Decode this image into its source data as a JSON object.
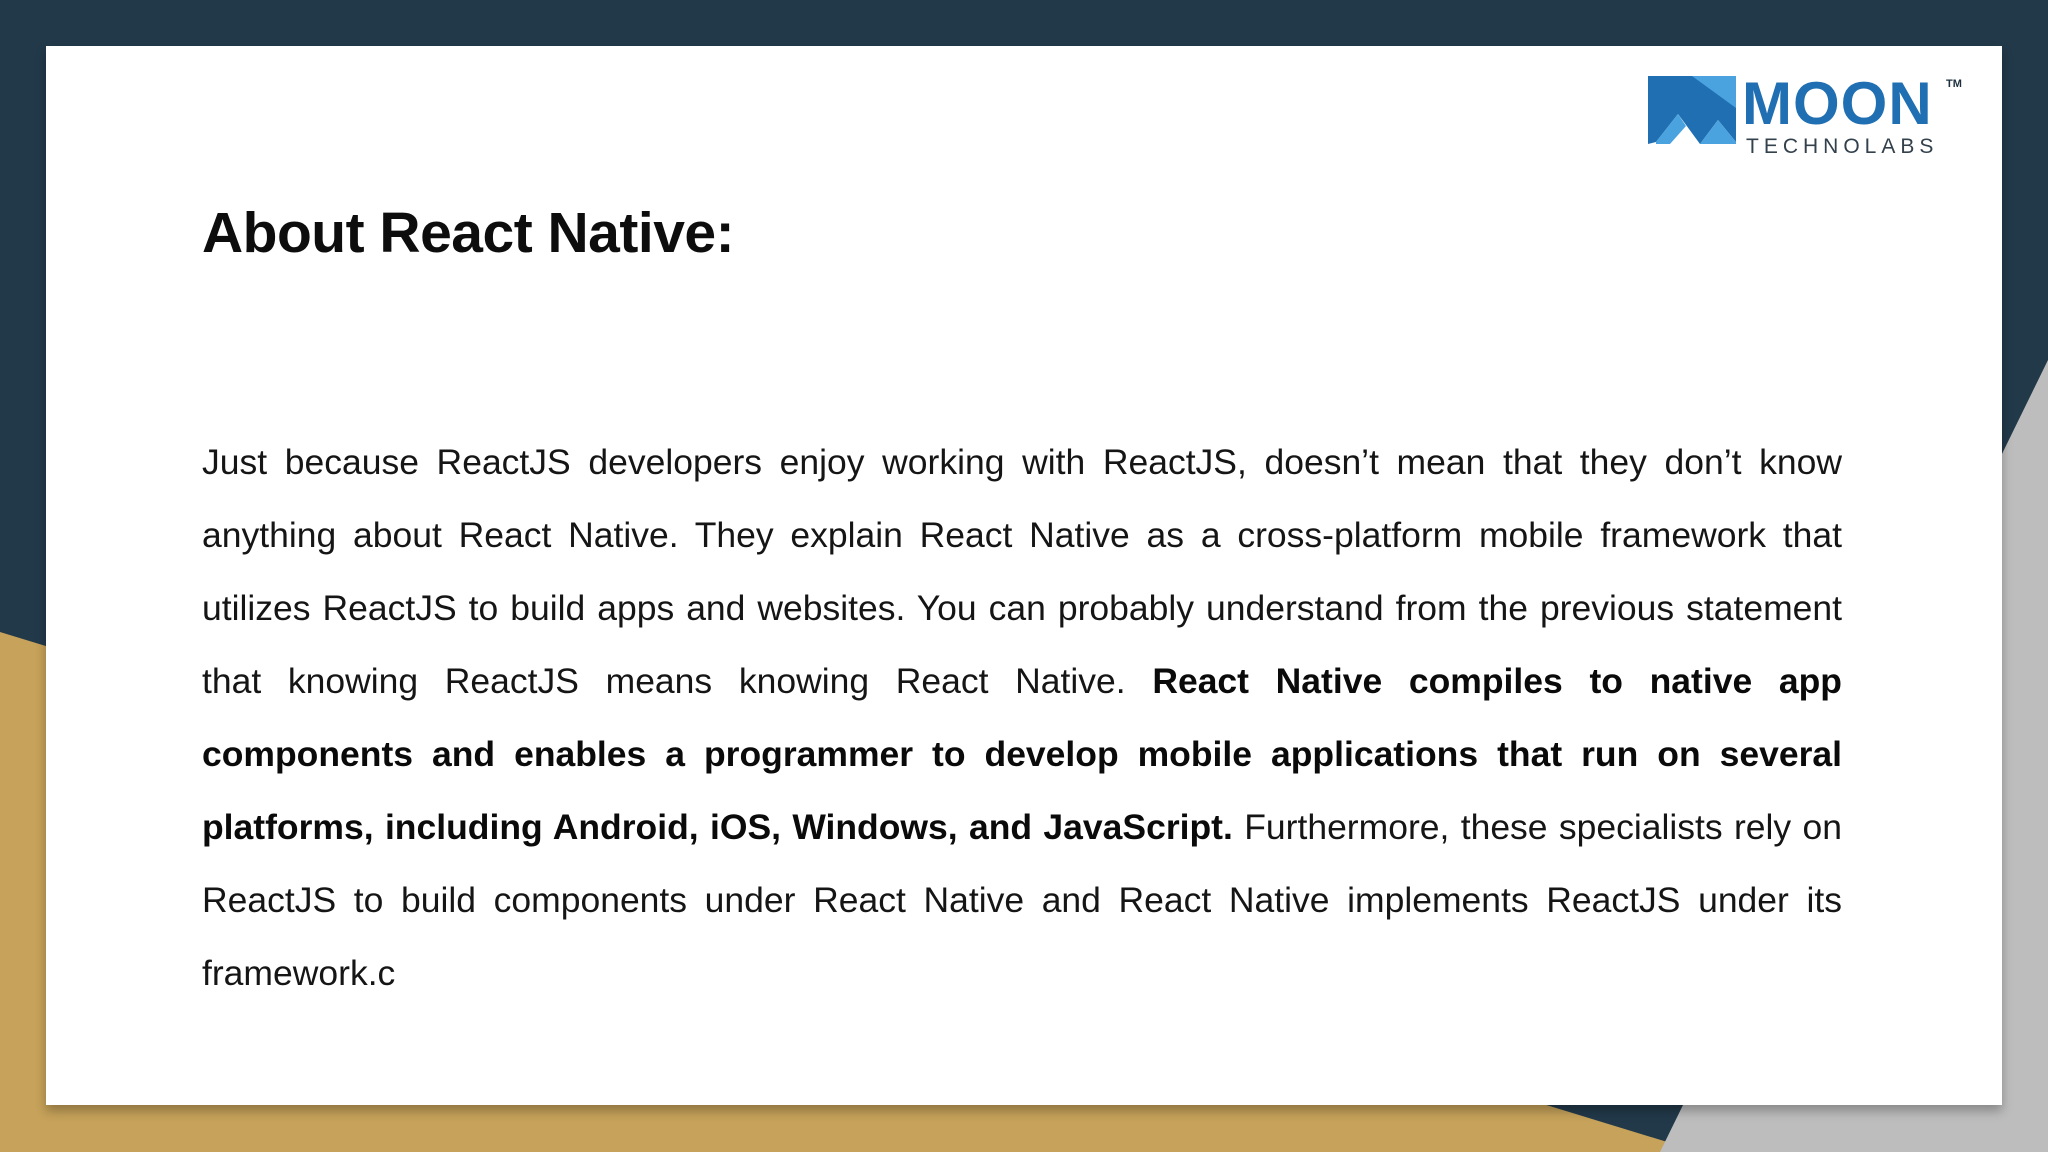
{
  "logo": {
    "brand": "MOON",
    "trademark": "TM",
    "tagline": "TECHNOLABS",
    "colors": {
      "dark_blue": "#1f6fb2",
      "light_blue": "#4aa3df"
    }
  },
  "slide": {
    "title": "About React Native:",
    "paragraph": {
      "part1": "Just because ReactJS developers enjoy working with ReactJS, doesn’t mean that they don’t know anything about React Native. They explain React Native as a cross-platform mobile framework that utilizes ReactJS to build apps and websites. You can probably understand from the previous statement that knowing ReactJS means knowing React Native. ",
      "bold": "React Native compiles to native app components and enables a programmer to develop mobile applications that run on several platforms, including Android, iOS, Windows, and JavaScript.",
      "part2": " Furthermore, these specialists rely on ReactJS to build components under React Native and React Native implements ReactJS under its framework.c"
    }
  },
  "theme": {
    "navy": "#22394a",
    "gold": "#c6a25a",
    "grey": "#bdbdbd",
    "card": "#ffffff"
  }
}
